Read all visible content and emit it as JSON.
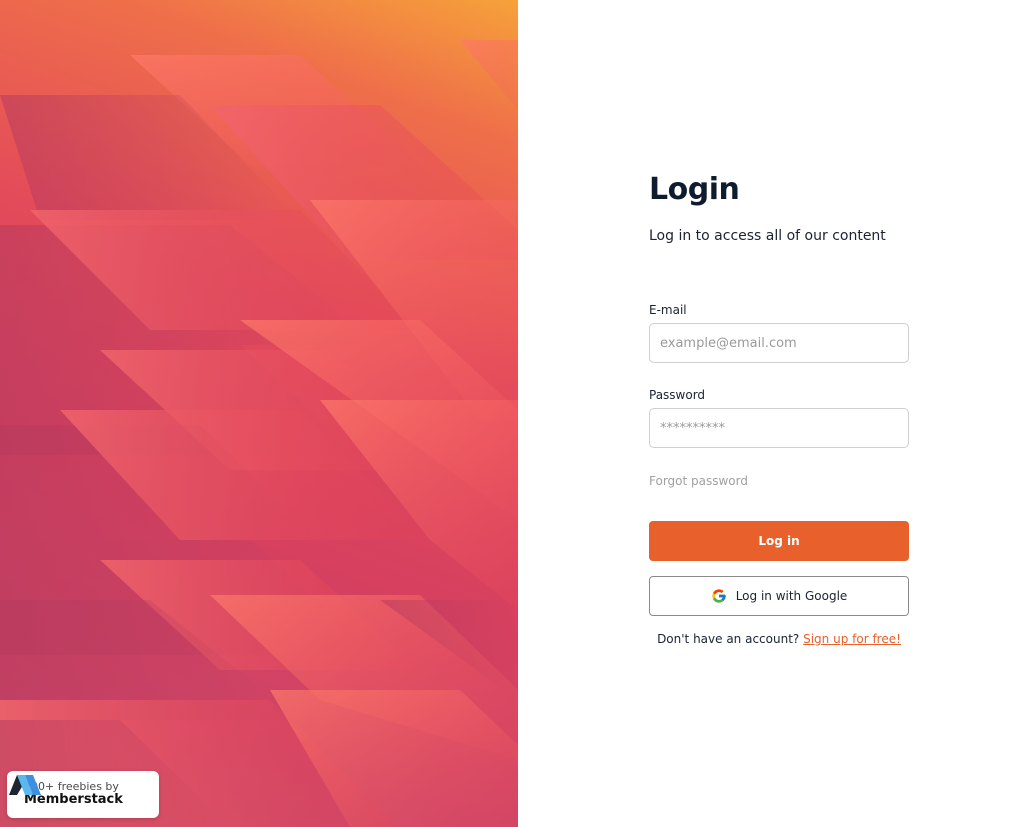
{
  "badge": {
    "subtitle": "200+ freebies by",
    "brand": "Memberstack"
  },
  "login": {
    "title": "Login",
    "subtitle": "Log in to access all of our content",
    "email_label": "E-mail",
    "email_placeholder": "example@email.com",
    "password_label": "Password",
    "password_placeholder": "**********",
    "forgot_label": "Forgot password",
    "login_button": "Log in",
    "google_button": "Log in with Google",
    "signup_prompt": "Don't have an account?",
    "signup_link": "Sign up for free!"
  },
  "colors": {
    "accent": "#e8602c",
    "title": "#0f1c2e",
    "hero_top": "#f6a23a",
    "hero_main": "#d7405f"
  },
  "icons": {
    "google": "google-icon",
    "brand_logo": "memberstack-logo-icon"
  }
}
